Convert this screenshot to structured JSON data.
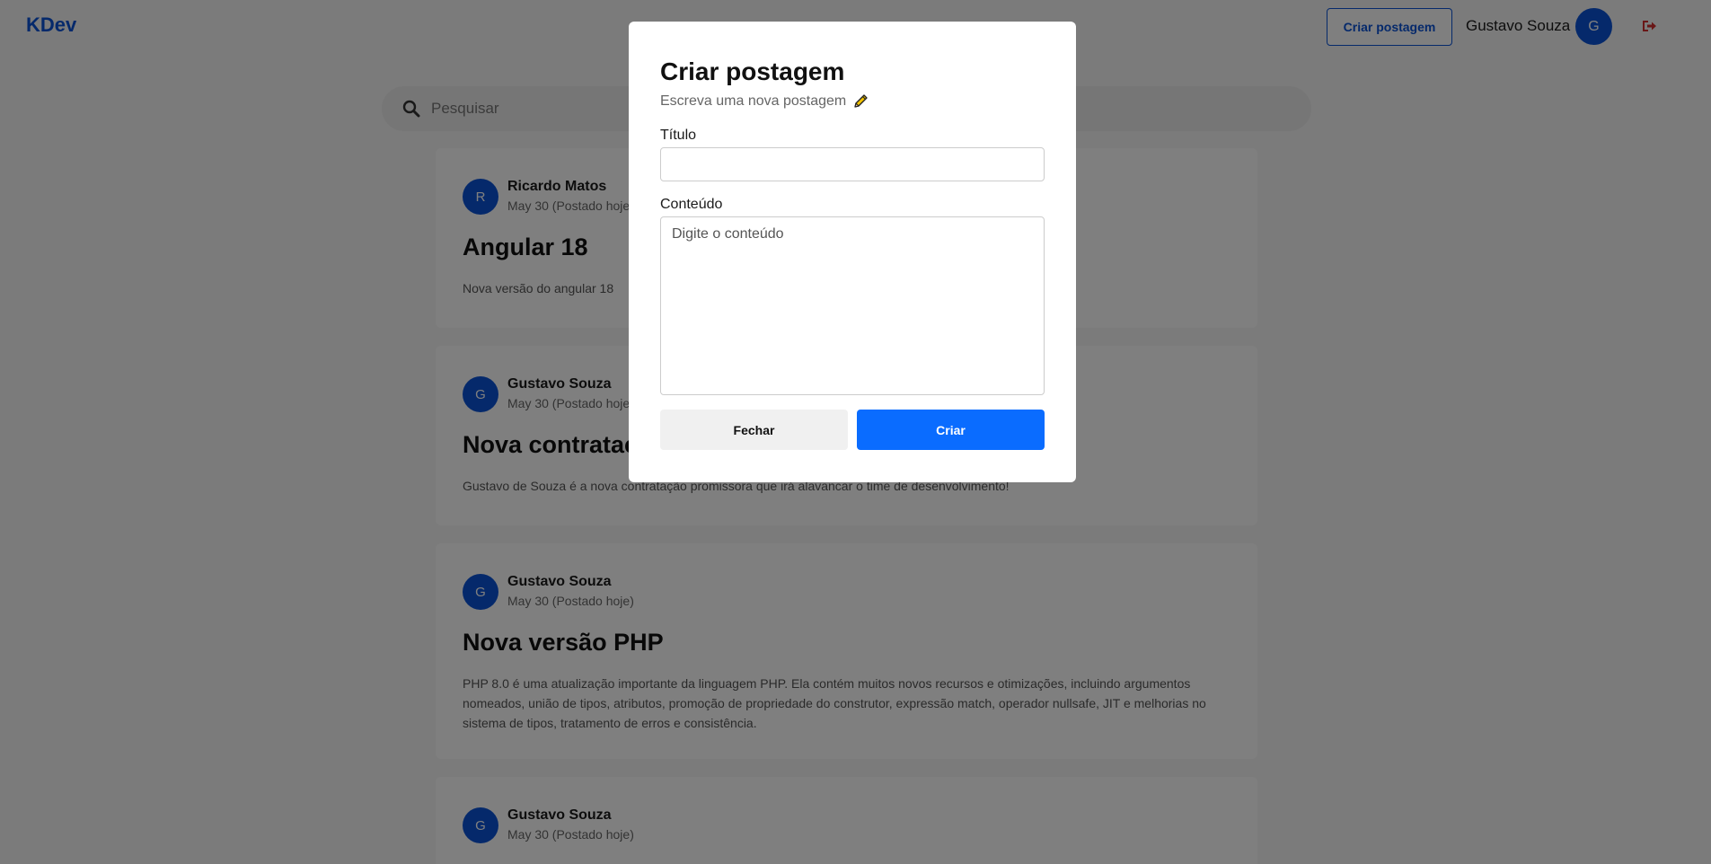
{
  "header": {
    "logo": "KDev",
    "create_post_label": "Criar postagem",
    "user_name": "Gustavo Souza",
    "user_initial": "G"
  },
  "search": {
    "placeholder": "Pesquisar"
  },
  "posts": [
    {
      "author_initial": "R",
      "author": "Ricardo Matos",
      "date": "May 30 (Postado hoje)",
      "title": "Angular 18",
      "content": "Nova versão do angular 18"
    },
    {
      "author_initial": "G",
      "author": "Gustavo Souza",
      "date": "May 30 (Postado hoje)",
      "title": "Nova contratação",
      "content": "Gustavo de Souza é a nova contratação promissora que irá alavancar o time de desenvolvimento!"
    },
    {
      "author_initial": "G",
      "author": "Gustavo Souza",
      "date": "May 30 (Postado hoje)",
      "title": "Nova versão PHP",
      "content": "PHP 8.0 é uma atualização importante da linguagem PHP. Ela contém muitos novos recursos e otimizações, incluindo argumentos nomeados, união de tipos, atributos, promoção de propriedade do construtor, expressão match, operador nullsafe, JIT e melhorias no sistema de tipos, tratamento de erros e consistência."
    },
    {
      "author_initial": "G",
      "author": "Gustavo Souza",
      "date": "May 30 (Postado hoje)",
      "title": "",
      "content": ""
    }
  ],
  "modal": {
    "title": "Criar postagem",
    "subtitle": "Escreva uma nova postagem",
    "title_label": "Título",
    "title_value": "",
    "content_label": "Conteúdo",
    "content_placeholder": "Digite o conteúdo",
    "close_label": "Fechar",
    "create_label": "Criar"
  },
  "colors": {
    "primary": "#0a52d6",
    "primary_button": "#0a6cff",
    "logout": "#d32f2f"
  }
}
